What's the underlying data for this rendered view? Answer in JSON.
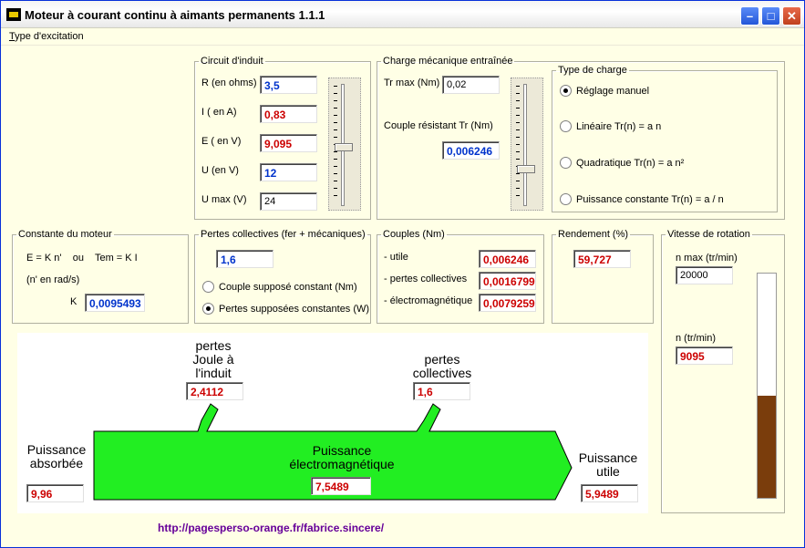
{
  "window": {
    "title": "Moteur à courant continu à aimants permanents   1.1.1",
    "menu": {
      "excitation_label": "Type d'excitation"
    }
  },
  "circuit": {
    "legend": "Circuit d'induit",
    "r_label": "R (en ohms)",
    "r_value": "3,5",
    "i_label": "I ( en A)",
    "i_value": "0,83",
    "e_label": "E ( en V)",
    "e_value": "9,095",
    "u_label": "U (en V)",
    "u_value": "12",
    "umax_label": "U max (V)",
    "umax_value": "24",
    "slider_level": 0.5
  },
  "charge": {
    "legend": "Charge mécanique entraînée",
    "trmax_label": "Tr max (Nm)",
    "trmax_value": "0,02",
    "tr_label": "Couple résistant Tr (Nm)",
    "tr_value": "0,006246",
    "slider_level": 0.31
  },
  "type_charge": {
    "legend": "Type de charge",
    "options": [
      {
        "label": "Réglage manuel",
        "selected": true
      },
      {
        "label": "Linéaire Tr(n) = a n",
        "selected": false
      },
      {
        "label": "Quadratique Tr(n) = a n²",
        "selected": false
      },
      {
        "label": "Puissance constante Tr(n) = a / n",
        "selected": false
      }
    ]
  },
  "constante": {
    "legend": "Constante du moteur",
    "formula": "E = K n'    ou    Tem = K I",
    "unit_note": "(n' en rad/s)",
    "k_label": "K",
    "k_value": "0,0095493"
  },
  "pertes": {
    "legend": "Pertes collectives (fer + mécaniques)",
    "value": "1,6",
    "options": [
      {
        "label": "Couple supposé constant (Nm)",
        "selected": false
      },
      {
        "label": "Pertes supposées constantes (W)",
        "selected": true
      }
    ]
  },
  "couples": {
    "legend": "Couples (Nm)",
    "utile_label": "- utile",
    "utile_value": "0,006246",
    "pertes_label": "- pertes collectives",
    "pertes_value": "0,0016799",
    "em_label": "- électromagnétique",
    "em_value": "0,0079259"
  },
  "rendement": {
    "legend": "Rendement (%)",
    "value": "59,727"
  },
  "vitesse": {
    "legend": "Vitesse de rotation",
    "nmax_label": "n max (tr/min)",
    "nmax_value": "20000",
    "n_label": "n (tr/min)",
    "n_value": "9095",
    "gauge_fraction": 0.455
  },
  "diagram": {
    "joule_label_1": "pertes",
    "joule_label_2": "Joule à",
    "joule_label_3": "l'induit",
    "joule_value": "2,4112",
    "coll_label_1": "pertes",
    "coll_label_2": "collectives",
    "coll_value": "1,6",
    "abs_label_1": "Puissance",
    "abs_label_2": "absorbée",
    "abs_value": "9,96",
    "em_label_1": "Puissance",
    "em_label_2": "électromagnétique",
    "em_value": "7,5489",
    "util_label_1": "Puissance",
    "util_label_2": "utile",
    "util_value": "5,9489",
    "arrow_color": "#22ee22"
  },
  "footer": {
    "url": "http://pagesperso-orange.fr/fabrice.sincere/"
  }
}
